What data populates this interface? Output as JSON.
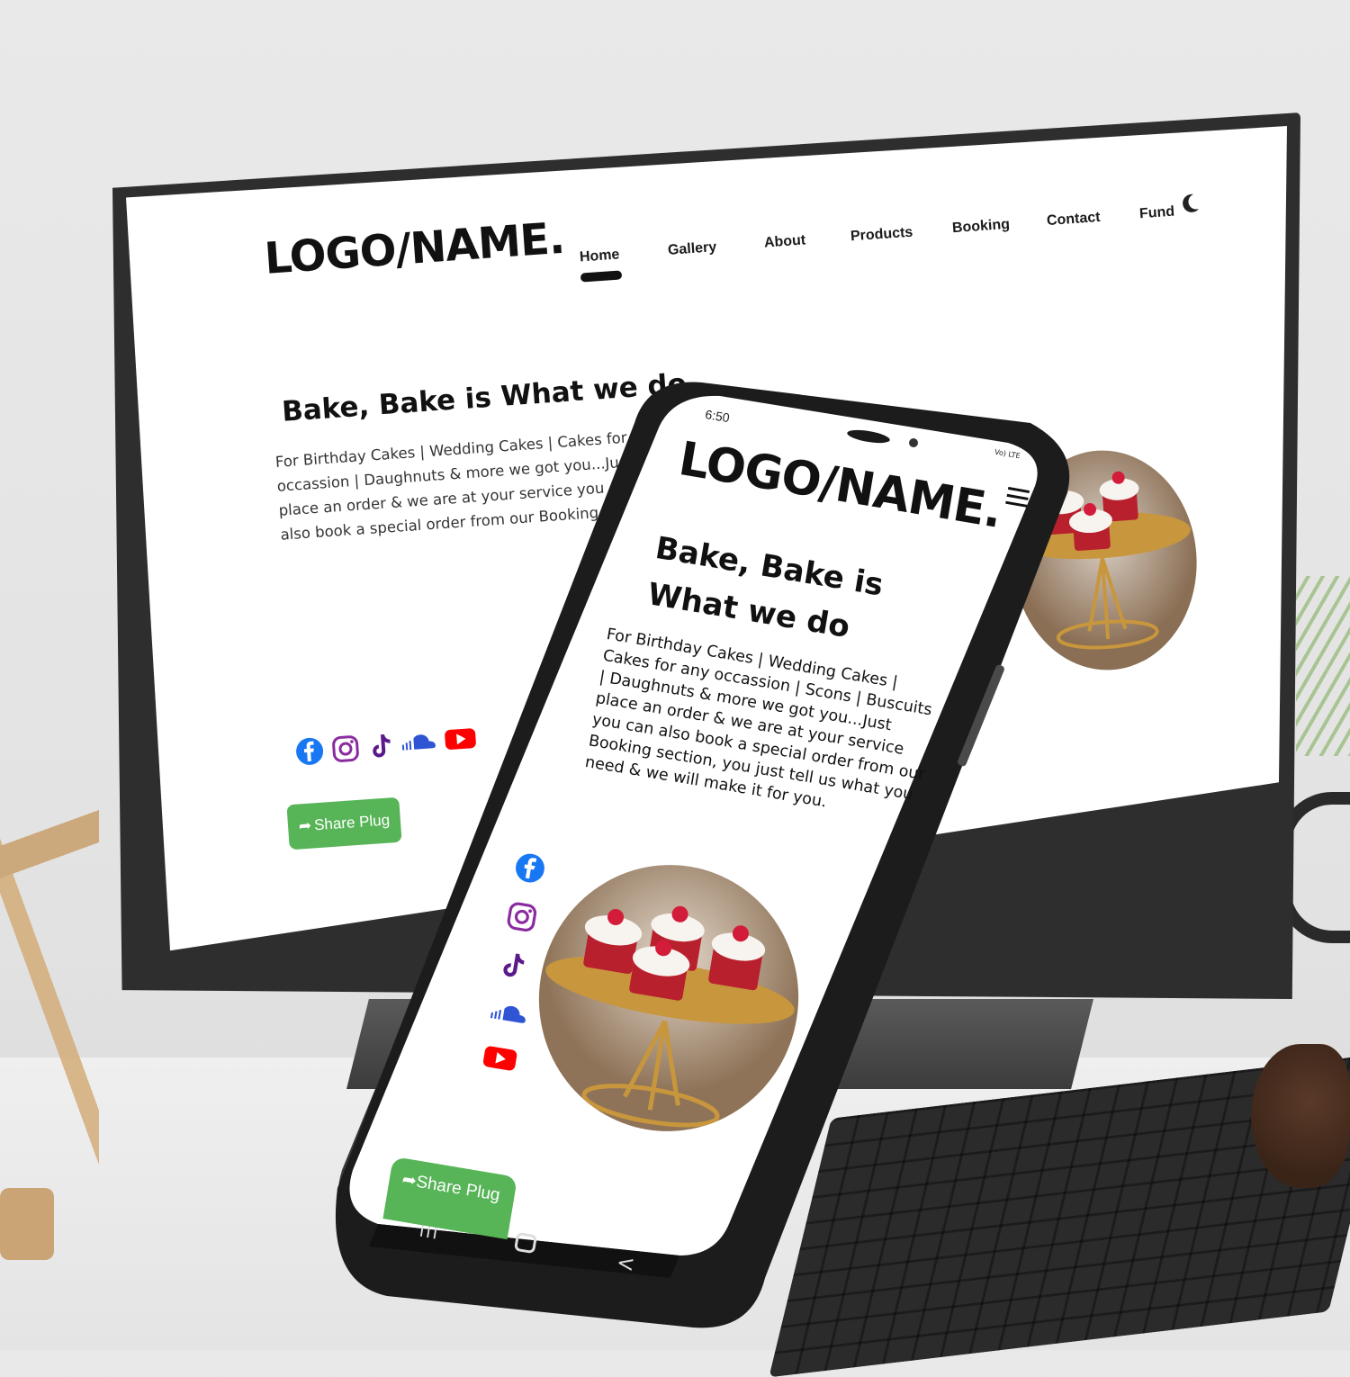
{
  "desktop": {
    "logo": "LOGO/NAME.",
    "nav": [
      {
        "label": "Home"
      },
      {
        "label": "Gallery"
      },
      {
        "label": "About"
      },
      {
        "label": "Products"
      },
      {
        "label": "Booking"
      },
      {
        "label": "Contact"
      },
      {
        "label": "Fund"
      }
    ],
    "title": "Bake, Bake is What we do",
    "body": "For Birthday Cakes | Wedding Cakes | Cakes for any occassion | Daughnuts & more we got you...Just place an order & we are at your service you can also book a special order from our Booking section, you just tell us what you need & we will make it for you.",
    "share_label": "Share Plug"
  },
  "phone": {
    "status_time": "6:50",
    "status_right": "Vo) LTE",
    "logo": "LOGO/NAME.",
    "title": "Bake, Bake is What we do",
    "body": "For Birthday Cakes | Wedding Cakes | Cakes for any occassion | Scons | Buscuits | Daughnuts & more we got you...Just place an order & we are at your service you can also book a special order from our Booking section, you just tell us what you need & we will make it for you.",
    "share_label": "Share Plug"
  },
  "social_icons": [
    "facebook-icon",
    "instagram-icon",
    "tiktok-icon",
    "soundcloud-icon",
    "youtube-icon"
  ],
  "colors": {
    "share_button": "#57b457",
    "facebook": "#1877f2",
    "instagram": "#8a2ba0",
    "tiktok": "#5b1a8a",
    "soundcloud": "#2f55d4",
    "youtube": "#ff0000"
  }
}
